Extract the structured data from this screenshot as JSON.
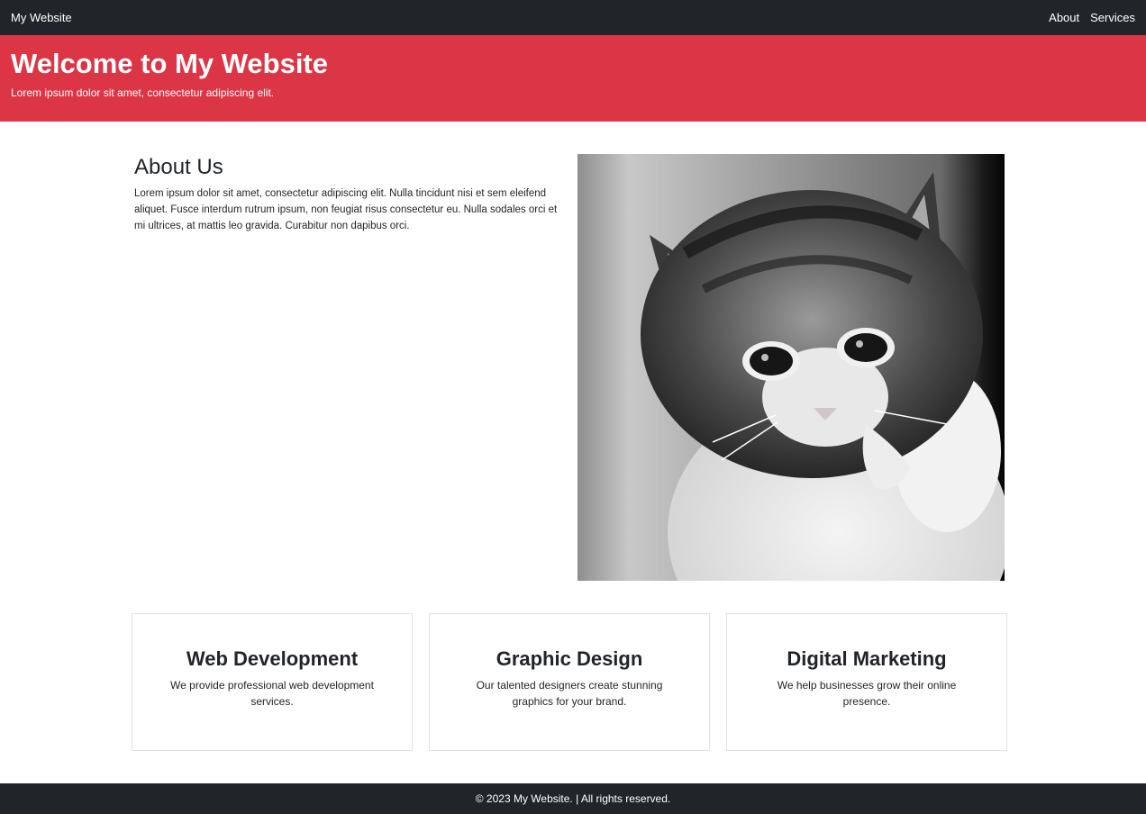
{
  "navbar": {
    "brand": "My Website",
    "links": [
      {
        "label": "About"
      },
      {
        "label": "Services"
      }
    ]
  },
  "hero": {
    "title": "Welcome to My Website",
    "subtitle": "Lorem ipsum dolor sit amet, consectetur adipiscing elit."
  },
  "about": {
    "title": "About Us",
    "text": "Lorem ipsum dolor sit amet, consectetur adipiscing elit. Nulla tincidunt nisi et sem eleifend aliquet. Fusce interdum rutrum ipsum, non feugiat risus consectetur eu. Nulla sodales orci et mi ultrices, at mattis leo gravida. Curabitur non dapibus orci."
  },
  "services": [
    {
      "title": "Web Development",
      "text": "We provide professional web development services."
    },
    {
      "title": "Graphic Design",
      "text": "Our talented designers create stunning graphics for your brand."
    },
    {
      "title": "Digital Marketing",
      "text": "We help businesses grow their online presence."
    }
  ],
  "footer": {
    "text": "© 2023 My Website. | All rights reserved."
  }
}
